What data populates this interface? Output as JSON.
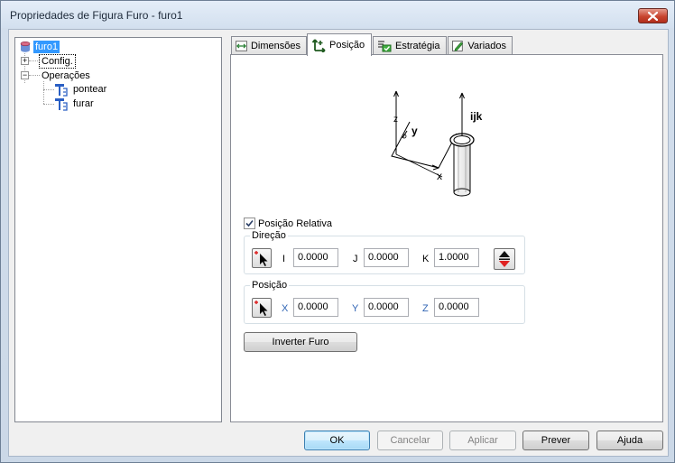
{
  "window": {
    "title": "Propriedades de Figura Furo - furo1"
  },
  "tree": {
    "root": "furo1",
    "config": "Config.",
    "operacoes": "Operações",
    "op_items": [
      "pontear",
      "furar"
    ]
  },
  "tabs": [
    "Dimensões",
    "Posição",
    "Estratégia",
    "Variados"
  ],
  "diagram": {
    "z": "z",
    "y": "y",
    "x": "x",
    "ijk": "ijk"
  },
  "posicao_relativa": {
    "label": "Posição Relativa",
    "checked": true
  },
  "direcao": {
    "title": "Direção",
    "i_label": "I",
    "i_value": "0.0000",
    "j_label": "J",
    "j_value": "0.0000",
    "k_label": "K",
    "k_value": "1.0000"
  },
  "posicao": {
    "title": "Posição",
    "x_label": "X",
    "x_value": "0.0000",
    "y_label": "Y",
    "y_value": "0.0000",
    "z_label": "Z",
    "z_value": "0.0000"
  },
  "inverter_label": "Inverter Furo",
  "buttons": {
    "ok": "OK",
    "cancel": "Cancelar",
    "apply": "Aplicar",
    "preview": "Prever",
    "help": "Ajuda"
  },
  "colors": {
    "close": "#c8452f",
    "selection": "#3399ff",
    "axis_labels": "#2f64b4"
  }
}
